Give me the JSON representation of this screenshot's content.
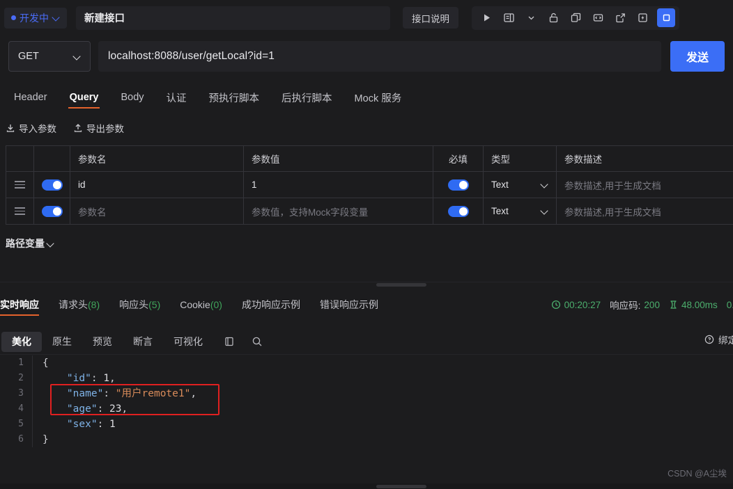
{
  "topbar": {
    "status_label": "开发中",
    "title": "新建接口",
    "desc_button": "接口说明",
    "tools": [
      {
        "name": "run-icon",
        "label": "运行"
      },
      {
        "name": "save-doc-icon",
        "label": "保存"
      },
      {
        "name": "chevron-down-icon",
        "label": "更多"
      },
      {
        "name": "unlock-icon",
        "label": "解锁"
      },
      {
        "name": "copy-icon",
        "label": "复制"
      },
      {
        "name": "code-icon",
        "label": "生成代码"
      },
      {
        "name": "share-icon",
        "label": "分享"
      },
      {
        "name": "lightning-icon",
        "label": "快捷"
      }
    ]
  },
  "url": {
    "method": "GET",
    "value": "localhost:8088/user/getLocal?id=1",
    "send_label": "发送"
  },
  "request_tabs": [
    {
      "label": "Header",
      "active": false
    },
    {
      "label": "Query",
      "active": true
    },
    {
      "label": "Body",
      "active": false
    },
    {
      "label": "认证",
      "active": false
    },
    {
      "label": "预执行脚本",
      "active": false
    },
    {
      "label": "后执行脚本",
      "active": false
    },
    {
      "label": "Mock 服务",
      "active": false
    }
  ],
  "io": {
    "import_label": "导入参数",
    "export_label": "导出参数"
  },
  "params_table": {
    "columns": [
      "参数名",
      "参数值",
      "必填",
      "类型",
      "参数描述"
    ],
    "rows": [
      {
        "enabled": true,
        "name": "id",
        "name_is_placeholder": false,
        "value": "1",
        "value_is_placeholder": false,
        "required": true,
        "type": "Text",
        "description": "参数描述,用于生成文档",
        "description_is_placeholder": true
      },
      {
        "enabled": true,
        "name": "参数名",
        "name_is_placeholder": true,
        "value": "参数值，支持Mock字段变量",
        "value_is_placeholder": true,
        "required": true,
        "type": "Text",
        "description": "参数描述,用于生成文档",
        "description_is_placeholder": true
      }
    ]
  },
  "path_variable": {
    "label": "路径变量"
  },
  "response_tabs": [
    {
      "label": "实时响应",
      "count": "",
      "active": true
    },
    {
      "label": "请求头",
      "count": "(8)",
      "active": false
    },
    {
      "label": "响应头",
      "count": "(5)",
      "active": false
    },
    {
      "label": "Cookie",
      "count": "(0)",
      "active": false
    },
    {
      "label": "成功响应示例",
      "count": "",
      "active": false
    },
    {
      "label": "错误响应示例",
      "count": "",
      "active": false
    }
  ],
  "response_status": {
    "time": "00:20:27",
    "code_label": "响应码:",
    "code_value": "200",
    "duration": "48.00ms",
    "size": "0."
  },
  "viewer_toolbar": {
    "segments": [
      {
        "label": "美化",
        "active": true
      },
      {
        "label": "原生",
        "active": false
      },
      {
        "label": "预览",
        "active": false
      },
      {
        "label": "断言",
        "active": false
      },
      {
        "label": "可视化",
        "active": false
      }
    ],
    "copy_icon": "copy-icon",
    "search_icon": "search-icon",
    "bind_label": "绑定"
  },
  "code_view": {
    "lines": [
      {
        "num": "1",
        "tokens": [
          {
            "t": "{",
            "c": "pun"
          }
        ]
      },
      {
        "num": "2",
        "tokens": [
          {
            "t": "    ",
            "c": "pun"
          },
          {
            "t": "\"id\"",
            "c": "key"
          },
          {
            "t": ": ",
            "c": "pun"
          },
          {
            "t": "1",
            "c": "num"
          },
          {
            "t": ",",
            "c": "pun"
          }
        ]
      },
      {
        "num": "3",
        "tokens": [
          {
            "t": "    ",
            "c": "pun"
          },
          {
            "t": "\"name\"",
            "c": "key"
          },
          {
            "t": ": ",
            "c": "pun"
          },
          {
            "t": "\"用户remote1\"",
            "c": "str"
          },
          {
            "t": ",",
            "c": "pun"
          }
        ]
      },
      {
        "num": "4",
        "tokens": [
          {
            "t": "    ",
            "c": "pun"
          },
          {
            "t": "\"age\"",
            "c": "key"
          },
          {
            "t": ": ",
            "c": "pun"
          },
          {
            "t": "23",
            "c": "num"
          },
          {
            "t": ",",
            "c": "pun"
          }
        ]
      },
      {
        "num": "5",
        "tokens": [
          {
            "t": "    ",
            "c": "pun"
          },
          {
            "t": "\"sex\"",
            "c": "key"
          },
          {
            "t": ": ",
            "c": "pun"
          },
          {
            "t": "1",
            "c": "num"
          }
        ]
      },
      {
        "num": "6",
        "tokens": [
          {
            "t": "}",
            "c": "pun"
          }
        ]
      }
    ]
  },
  "watermark": "CSDN @A尘埃",
  "colors": {
    "accent_blue": "#3b6ef6",
    "tab_underline": "#e4622c",
    "status_green": "#4caf6d",
    "annotation_red": "#e02020",
    "background": "#1c1c1e"
  }
}
